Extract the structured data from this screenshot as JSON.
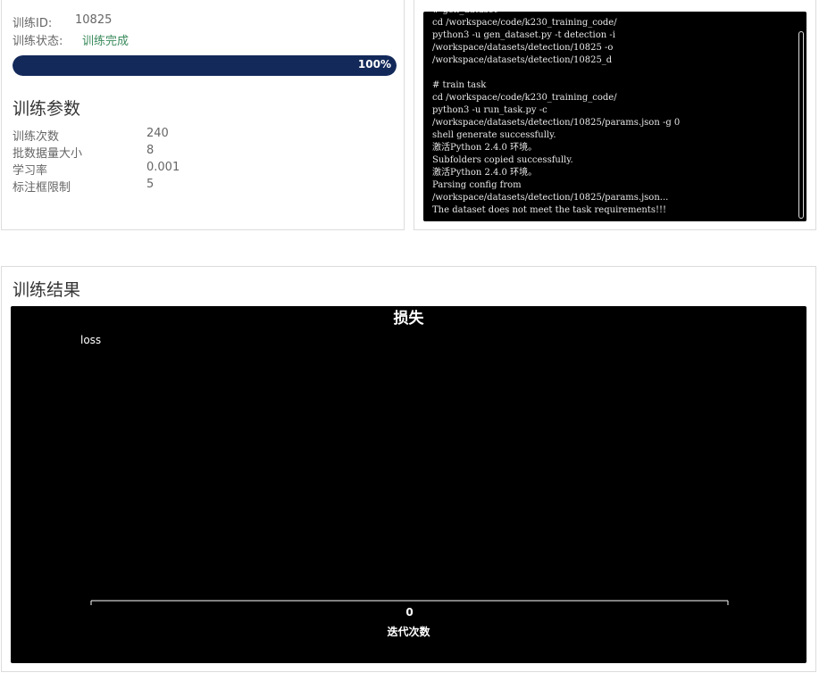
{
  "training_info": {
    "id_label": "训练ID:",
    "id_value": "10825",
    "status_label": "训练状态:",
    "status_value": "训练完成",
    "progress_percent": 100,
    "progress_text": "100%"
  },
  "params": {
    "title": "训练参数",
    "items": [
      {
        "label": "训练次数",
        "value": "240"
      },
      {
        "label": "批数据量大小",
        "value": "8"
      },
      {
        "label": "学习率",
        "value": "0.001"
      },
      {
        "label": "标注框限制",
        "value": "5"
      }
    ]
  },
  "log": {
    "lines": [
      "# gen_dataset",
      "cd /workspace/code/k230_training_code/",
      "python3 -u gen_dataset.py -t detection -i",
      "/workspace/datasets/detection/10825 -o",
      "/workspace/datasets/detection/10825_d",
      "",
      "# train task",
      "cd /workspace/code/k230_training_code/",
      "python3 -u run_task.py -c",
      "/workspace/datasets/detection/10825/params.json -g 0",
      "shell generate successfully.",
      "激活Python 2.4.0 环境。",
      "Subfolders copied successfully.",
      "激活Python 2.4.0 环境。",
      "Parsing config from",
      "/workspace/datasets/detection/10825/params.json...",
      "The dataset does not meet the task requirements!!!"
    ]
  },
  "results": {
    "title": "训练结果"
  },
  "chart_data": {
    "type": "line",
    "title": "损失",
    "xlabel": "迭代次数",
    "ylabel": "",
    "x_ticks": [
      "0"
    ],
    "series": [
      {
        "name": "loss",
        "values": []
      }
    ],
    "background": "#000000",
    "text_color": "#ffffff",
    "legend": "top-left",
    "grid": false
  },
  "colors": {
    "progress": "#13295a",
    "status": "#3a8a5b"
  }
}
